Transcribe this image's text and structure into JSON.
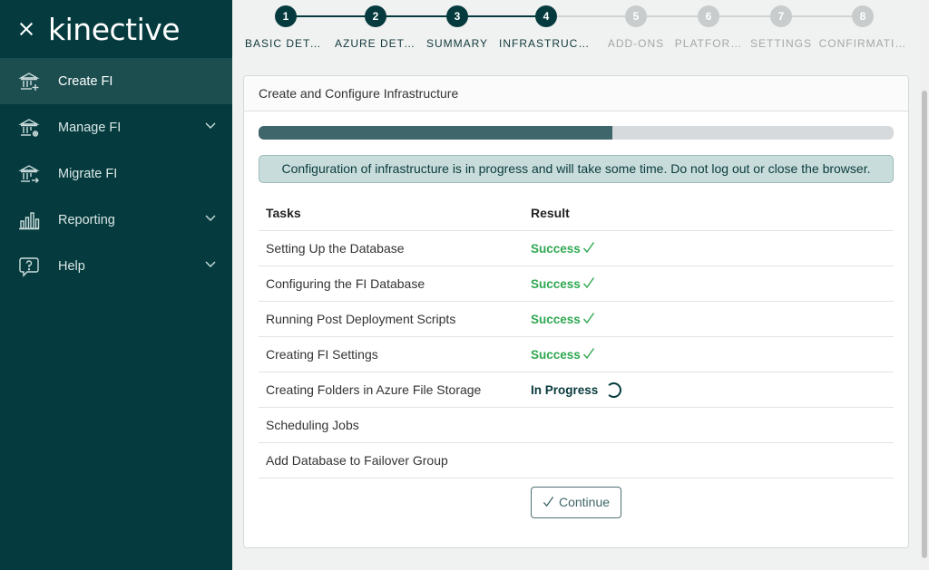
{
  "app": {
    "logo": "kinective"
  },
  "sidebar": {
    "items": [
      {
        "label": "Create FI",
        "active": true,
        "icon": "bank-plus-icon"
      },
      {
        "label": "Manage FI",
        "expandable": true,
        "icon": "bank-gear-icon"
      },
      {
        "label": "Migrate FI",
        "icon": "bank-arrow-icon"
      },
      {
        "label": "Reporting",
        "expandable": true,
        "icon": "bar-chart-icon"
      },
      {
        "label": "Help",
        "expandable": true,
        "icon": "help-bubble-icon"
      }
    ]
  },
  "stepper": {
    "steps": [
      {
        "num": "1",
        "label": "BASIC DETA…",
        "state": "done"
      },
      {
        "num": "2",
        "label": "AZURE DETA…",
        "state": "done"
      },
      {
        "num": "3",
        "label": "SUMMARY",
        "state": "done"
      },
      {
        "num": "4",
        "label": "INFRASTRUCT…",
        "state": "done"
      },
      {
        "num": "5",
        "label": "ADD-ONS",
        "state": "todo"
      },
      {
        "num": "6",
        "label": "PLATFOR…",
        "state": "todo"
      },
      {
        "num": "7",
        "label": "SETTINGS",
        "state": "todo"
      },
      {
        "num": "8",
        "label": "CONFIRMATI…",
        "state": "todo"
      }
    ]
  },
  "card": {
    "title": "Create and Configure Infrastructure",
    "progress": 0.557,
    "alert": "Configuration of infrastructure is in progress and will take some time. Do not log out or close the browser.",
    "table": {
      "headers": {
        "task": "Tasks",
        "result": "Result"
      },
      "rows": [
        {
          "task": "Setting Up the Database",
          "result": "Success",
          "status": "success"
        },
        {
          "task": "Configuring the FI Database",
          "result": "Success",
          "status": "success"
        },
        {
          "task": "Running Post Deployment Scripts",
          "result": "Success",
          "status": "success"
        },
        {
          "task": "Creating FI Settings",
          "result": "Success",
          "status": "success"
        },
        {
          "task": "Creating Folders in Azure File Storage",
          "result": "In Progress",
          "status": "progress"
        },
        {
          "task": "Scheduling Jobs",
          "result": "",
          "status": "pending"
        },
        {
          "task": "Add Database to Failover Group",
          "result": "",
          "status": "pending"
        }
      ]
    },
    "continue_label": "Continue"
  },
  "colors": {
    "sidebar": "#053b3e",
    "success": "#2fa851",
    "accent": "#3f666a"
  }
}
